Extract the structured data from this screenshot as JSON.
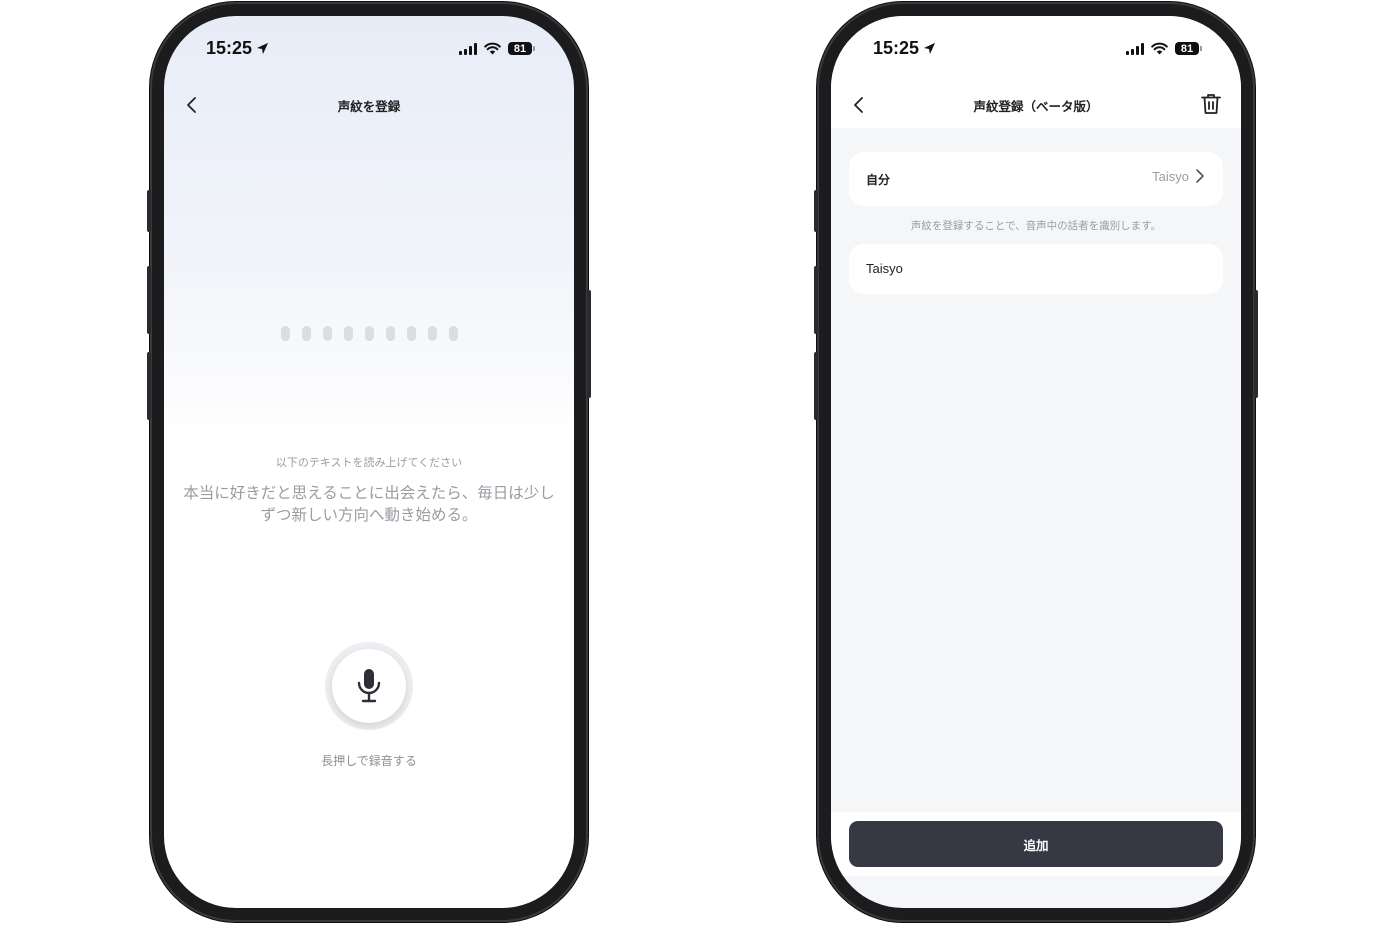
{
  "status_bar": {
    "time": "15:25",
    "battery": "81"
  },
  "screen1": {
    "title": "声紋を登録",
    "instruction": "以下のテキストを読み上げてください",
    "read_text": "本当に好きだと思えることに出会えたら、毎日は少しずつ新しい方向へ動き始める。",
    "mic_label": "長押しで録音する"
  },
  "screen2": {
    "title": "声紋登録（ベータ版）",
    "self_label": "自分",
    "self_value": "Taisyo",
    "hint": "声紋を登録することで、音声中の話者を識別します。",
    "name_value": "Taisyo",
    "add_label": "追加"
  }
}
